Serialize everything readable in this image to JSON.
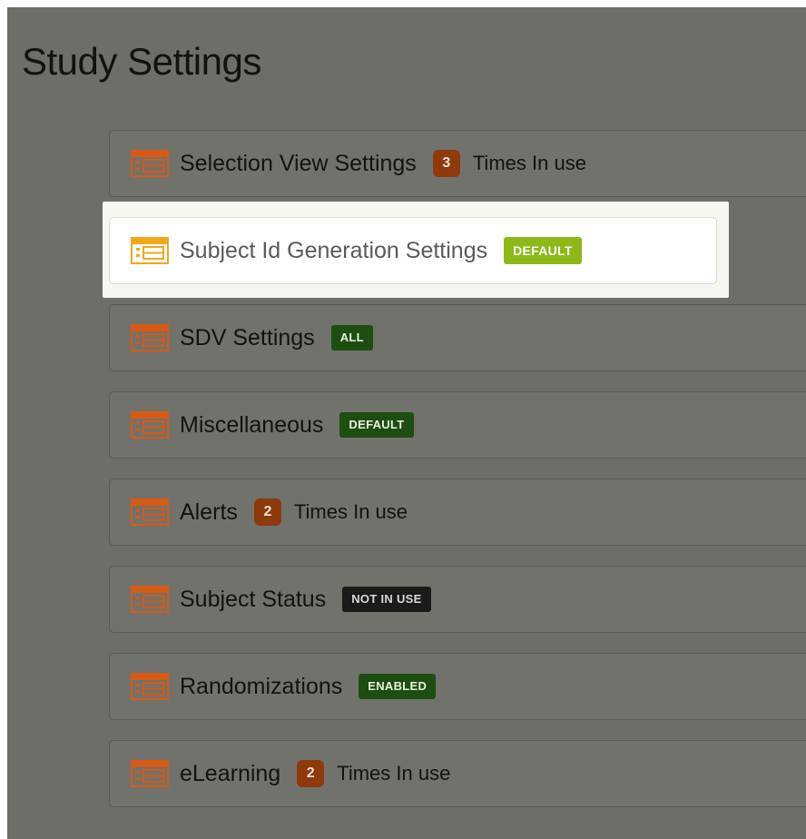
{
  "page": {
    "title": "Study Settings"
  },
  "rows": [
    {
      "label": "Selection View Settings",
      "count": "3",
      "usage": "Times In use"
    },
    {
      "label": "Subject Id Generation Settings",
      "badge": "DEFAULT"
    },
    {
      "label": "SDV Settings",
      "badge": "ALL"
    },
    {
      "label": "Miscellaneous",
      "badge": "DEFAULT"
    },
    {
      "label": "Alerts",
      "count": "2",
      "usage": "Times In use"
    },
    {
      "label": "Subject Status",
      "badge": "NOT IN USE"
    },
    {
      "label": "Randomizations",
      "badge": "ENABLED"
    },
    {
      "label": "eLearning",
      "count": "2",
      "usage": "Times In use"
    }
  ],
  "colors": {
    "icon_default": "#d65a16",
    "icon_highlight": "#f2a71b",
    "badge_green": "#1e4d12",
    "badge_lime": "#8db81a",
    "badge_dark": "#1a1a1a",
    "count_bg": "#8e3a0d"
  },
  "icons": {
    "row_icon": "list-settings-icon"
  }
}
